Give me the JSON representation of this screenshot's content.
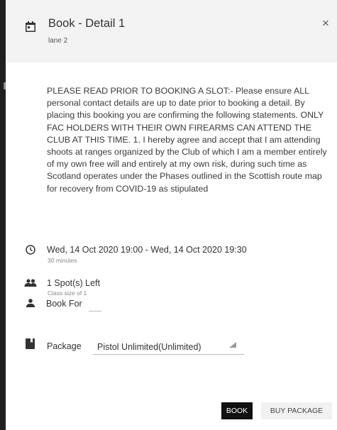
{
  "dialog": {
    "title": "Book - Detail 1",
    "subtitle": "lane 2",
    "close_label": "×"
  },
  "description": "PLEASE READ PRIOR TO BOOKING A SLOT:- Please ensure ALL personal contact details are up to date prior to booking a detail. By placing this booking you are confirming the following statements. ONLY FAC HOLDERS WITH THEIR OWN FIREARMS CAN ATTEND THE CLUB AT THIS TIME. 1. I hereby agree and accept that I am attending shoots at ranges organized by the Club of which I am a member entirely of my own free will and entirely at my own risk, during such time as Scotland operates under the Phases outlined in the Scottish route map for recovery from COVID-19 as stipulated",
  "schedule": {
    "time_range": "Wed, 14 Oct 2020 19:00 - Wed, 14 Oct 2020 19:30",
    "duration": "30 minutes"
  },
  "spots": {
    "left": "1 Spot(s) Left",
    "class_size": "Class size of 1"
  },
  "book_for": {
    "label": "Book For"
  },
  "package": {
    "label": "Package",
    "selected": "Pistol Unlimited(Unlimited)"
  },
  "actions": {
    "book": "BOOK",
    "buy_package": "BUY PACKAGE"
  },
  "icons": {
    "calendar": "calendar-icon",
    "clock": "clock-icon",
    "group": "people-icon",
    "person": "person-icon",
    "package": "book-icon"
  }
}
